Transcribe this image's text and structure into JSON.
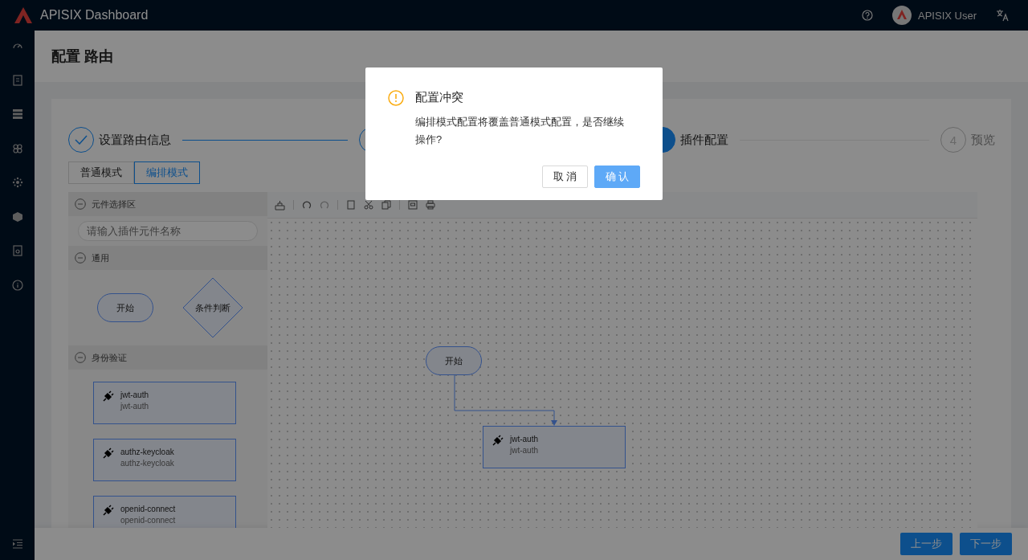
{
  "header": {
    "title": "APISIX Dashboard",
    "user": "APISIX User"
  },
  "page_title": "配置 路由",
  "steps": [
    {
      "title": "设置路由信息",
      "finished": true,
      "active": false
    },
    {
      "finished": true,
      "active": false
    },
    {
      "title": "插件配置",
      "finished": false,
      "active": true
    },
    {
      "number": "4",
      "title": "预览",
      "finished": false,
      "active": false
    }
  ],
  "modes": [
    {
      "label": "普通模式",
      "selected": false
    },
    {
      "label": "编排模式",
      "selected": true
    }
  ],
  "palette": {
    "sections": [
      {
        "title": "元件选择区",
        "expanded": true,
        "kind": "search",
        "placeholder": "请输入插件元件名称"
      },
      {
        "title": "通用",
        "expanded": true,
        "kind": "shapes",
        "items": [
          {
            "kind": "terminal",
            "label": "开始"
          },
          {
            "kind": "decision",
            "label": "条件判断"
          }
        ]
      },
      {
        "title": "身份验证",
        "expanded": true,
        "kind": "plugins",
        "items": [
          {
            "kind": "plugin",
            "name": "jwt-auth",
            "description": "jwt-auth"
          },
          {
            "kind": "plugin",
            "name": "authz-keycloak",
            "description": "authz-keycloak"
          },
          {
            "kind": "plugin",
            "name": "openid-connect",
            "description": "openid-connect"
          }
        ]
      }
    ]
  },
  "canvas": {
    "nodes": [
      {
        "kind": "terminal",
        "label": "开始"
      },
      {
        "kind": "plugin",
        "name": "jwt-auth",
        "description": "jwt-auth"
      }
    ]
  },
  "dialog": {
    "title": "配置冲突",
    "message": "编排模式配置将覆盖普通模式配置，是否继续操作?",
    "buttons": [
      {
        "label": "取 消",
        "kind": "default"
      },
      {
        "label": "确 认",
        "kind": "primary"
      }
    ]
  },
  "footer": {
    "buttons": [
      {
        "label": "上一步"
      },
      {
        "label": "下一步"
      }
    ]
  }
}
